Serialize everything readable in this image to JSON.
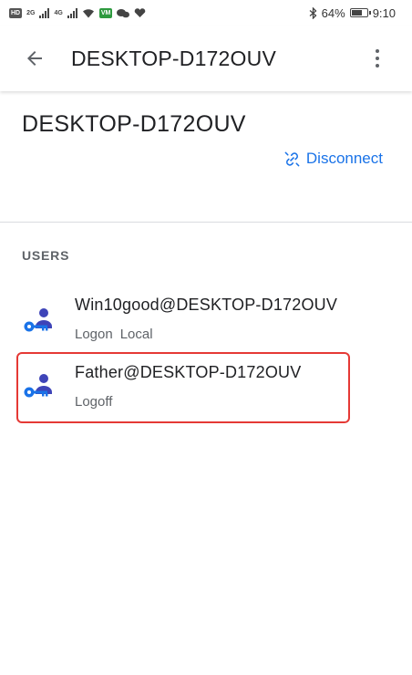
{
  "status_bar": {
    "left_icons": [
      "HD",
      "2G",
      "4G",
      "wifi-icon",
      "wechat-icon",
      "signal-icon"
    ],
    "battery": "64%",
    "time": "9:10"
  },
  "app_bar": {
    "title": "DESKTOP-D172OUV"
  },
  "device": {
    "name": "DESKTOP-D172OUV",
    "disconnect_label": "Disconnect"
  },
  "users_section": {
    "label": "USERS",
    "items": [
      {
        "name": "Win10good@DESKTOP-D172OUV",
        "status": "Logon",
        "session": "Local"
      },
      {
        "name": "Father@DESKTOP-D172OUV",
        "status": "Logoff",
        "session": ""
      }
    ]
  },
  "colors": {
    "accent": "#1a73e8",
    "user_icon": "#3e44b8",
    "highlight": "#e53935"
  }
}
